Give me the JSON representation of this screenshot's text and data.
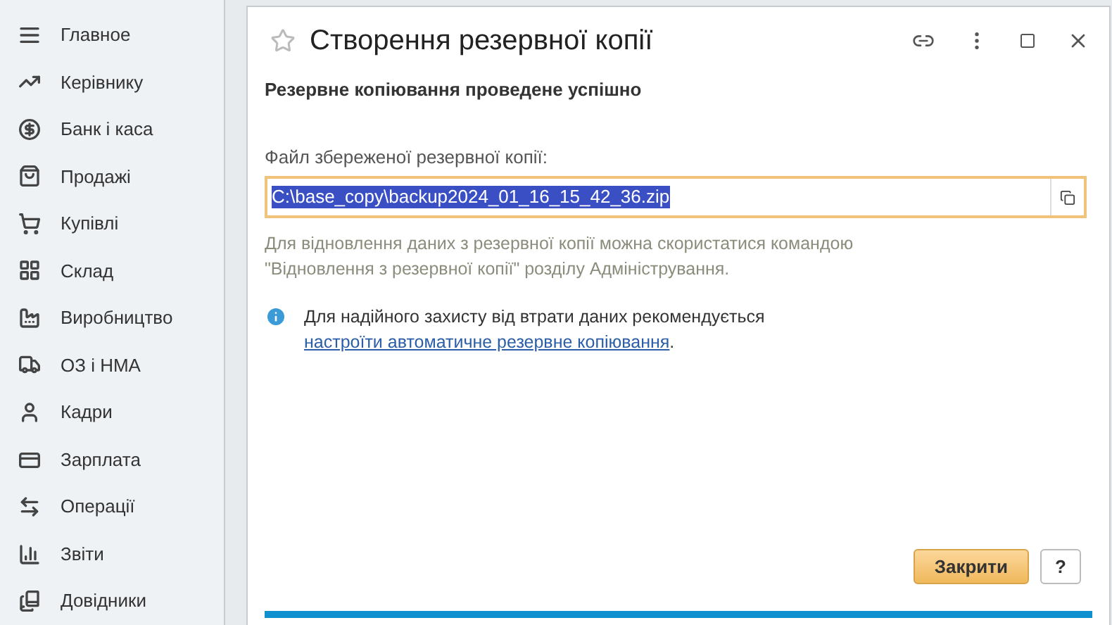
{
  "sidebar": {
    "items": [
      {
        "label": "Главное"
      },
      {
        "label": "Керівнику"
      },
      {
        "label": "Банк і каса"
      },
      {
        "label": "Продажі"
      },
      {
        "label": "Купівлі"
      },
      {
        "label": "Склад"
      },
      {
        "label": "Виробництво"
      },
      {
        "label": "ОЗ і НМА"
      },
      {
        "label": "Кадри"
      },
      {
        "label": "Зарплата"
      },
      {
        "label": "Операції"
      },
      {
        "label": "Звіти"
      },
      {
        "label": "Довідники"
      }
    ]
  },
  "dialog": {
    "title": "Створення резервної копії",
    "heading": "Резервне копіювання проведене успішно",
    "file_label": "Файл збереженої резервної копії:",
    "file_field": {
      "value": "C:\\base_copy\\backup2024_01_16_15_42_36.zip",
      "focused": true,
      "text_selected": true
    },
    "hint": "Для відновлення даних з резервної копії можна скористатися командою \"Відновлення з резервної копії\" розділу Адміністрування.",
    "info_text": "Для надійного захисту від втрати даних рекомендується",
    "info_link": "настроїти автоматичне резервне копіювання",
    "info_end": ".",
    "buttons": [
      {
        "label": "Закрити",
        "kind": "primary"
      },
      {
        "label": "?",
        "kind": "plain"
      }
    ]
  }
}
